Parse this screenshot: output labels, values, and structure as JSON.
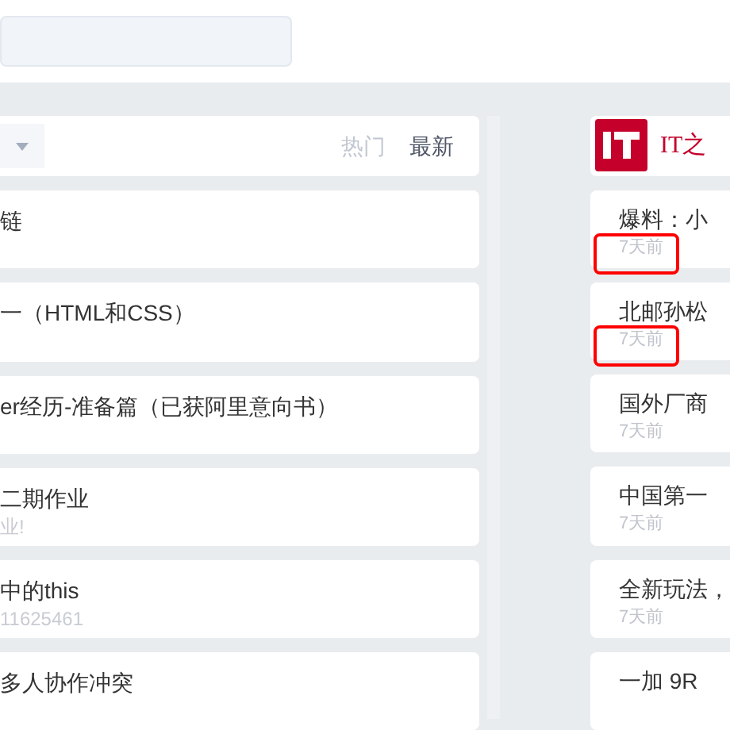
{
  "feed_tabs": [
    {
      "label": "热门",
      "selected": false
    },
    {
      "label": "最新",
      "selected": true
    }
  ],
  "articles": [
    {
      "title": "链"
    },
    {
      "title": "一（HTML和CSS）"
    },
    {
      "title": "er经历-准备篇（已获阿里意向书）"
    },
    {
      "title": "二期作业",
      "subtitle": "业!"
    },
    {
      "title": "中的this",
      "subtitle": "11625461"
    },
    {
      "title": "多人协作冲突"
    }
  ],
  "news": {
    "source": "IT之",
    "items": [
      {
        "title": "爆料：小",
        "time": "7天前",
        "highlighted": true
      },
      {
        "title": "北邮孙松",
        "time": "7天前",
        "highlighted": true
      },
      {
        "title": "国外厂商",
        "time": "7天前",
        "highlighted": false
      },
      {
        "title": "中国第一",
        "time": "7天前",
        "highlighted": false
      },
      {
        "title": "全新玩法，",
        "time": "7天前",
        "highlighted": false
      },
      {
        "title": "一加 9R",
        "highlighted": false
      }
    ]
  }
}
